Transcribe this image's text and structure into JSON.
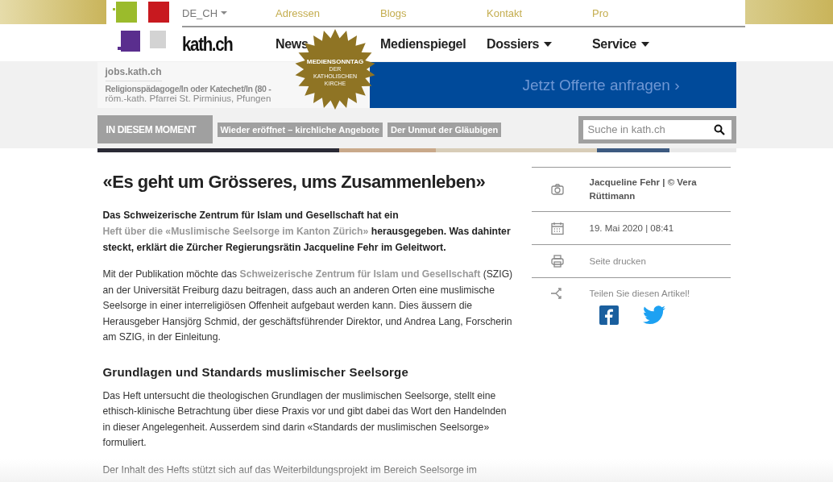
{
  "header": {
    "language": "DE_CH",
    "top_links": [
      "Adressen",
      "Blogs",
      "Kontakt",
      "Pro"
    ],
    "logo": "kath.ch",
    "main_nav": [
      {
        "label": "News",
        "dropdown": false
      },
      {
        "label": "Medienspiegel",
        "dropdown": false
      },
      {
        "label": "Dossiers",
        "dropdown": true
      },
      {
        "label": "Service",
        "dropdown": true
      }
    ]
  },
  "badge": {
    "title": "MEDIENSONNTAG",
    "lines": [
      "DER",
      "KATHOLISCHEN",
      "KIRCHE"
    ]
  },
  "jobs": {
    "site": "jobs.kath.ch",
    "title": "Religionspädagoge/In oder Katechet/In (80 -",
    "employer": "röm.-kath. Pfarrei St. Pirminius, Pfungen"
  },
  "banner": {
    "text": "Jetzt Offerte anfragen ›"
  },
  "moment": {
    "label": "IN DIESEM MOMENT",
    "tags": [
      "Wieder eröffnet – kirchliche Angebote",
      "Der Unmut der Gläubigen"
    ]
  },
  "search": {
    "placeholder": "Suche in kath.ch"
  },
  "article": {
    "title": "«Es geht um Grösseres, ums Zusammenleben»",
    "lead": {
      "before": "Das Schweizerische Zentrum für Islam und Gesellschaft hat ein",
      "link": "Heft über die «Muslimische Seelsorge im Kanton Zürich»",
      "after": "herausgegeben. Was dahinter steckt, erklärt die Zürcher Regierungsrätin Jacqueline Fehr im Geleitwort."
    },
    "blocks": [
      {
        "kind": "linked",
        "before": "Mit der Publikation möchte das",
        "link": "Schweizerische Zentrum für Islam und Gesellschaft",
        "after": "(SZIG) an der Universität Freiburg dazu beitragen, dass auch an anderen Orten eine muslimische Seelsorge in einer interreligiösen Offenheit aufgebaut werden kann. Dies äussern die Herausgeber Hansjörg Schmid, der geschäftsführender Direktor, und Andrea Lang, Forscherin am SZIG, in der Einleitung."
      },
      {
        "kind": "heading",
        "text": "Grundlagen und Standards muslimischer Seelsorge"
      },
      {
        "kind": "paragraph",
        "text": "Das Heft untersucht die theologischen Grundlagen der muslimischen Seelsorge, stellt eine ethisch-klinische Betrachtung über diese Praxis vor und gibt dabei das Wort den Handelnden in dieser Angelegenheit. Ausserdem sind darin «Standards der muslimischen Seelsorge» formuliert."
      },
      {
        "kind": "paragraph",
        "text": "Der Inhalt des Hefts stützt sich auf das Weiterbildungsprojekt im Bereich Seelsorge im"
      }
    ]
  },
  "sidebar": [
    {
      "text": "Jacqueline Fehr | © Vera Rüttimann"
    },
    {
      "kind": "date",
      "text": "19. Mai 2020 | 08:41"
    },
    {
      "kind": "print",
      "text": "Seite drucken"
    },
    {
      "kind": "share",
      "text": "Teilen Sie diesen Artikel!"
    }
  ]
}
